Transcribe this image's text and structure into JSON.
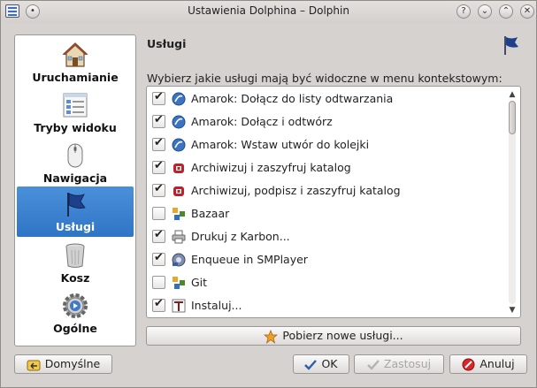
{
  "window": {
    "title": "Ustawienia Dolphina – Dolphin",
    "help_glyph": "?",
    "minimize_glyph": "⌄",
    "maximize_glyph": "⌃",
    "close_glyph": "✕",
    "menu_glyph": "•"
  },
  "sidebar": {
    "items": [
      {
        "label": "Uruchamianie",
        "icon": "house-icon",
        "selected": false
      },
      {
        "label": "Tryby widoku",
        "icon": "view-modes-icon",
        "selected": false
      },
      {
        "label": "Nawigacja",
        "icon": "mouse-icon",
        "selected": false
      },
      {
        "label": "Usługi",
        "icon": "flag-icon",
        "selected": true
      },
      {
        "label": "Kosz",
        "icon": "trash-icon",
        "selected": false
      },
      {
        "label": "Ogólne",
        "icon": "gear-icon",
        "selected": false
      }
    ]
  },
  "main": {
    "heading": "Usługi",
    "description": "Wybierz jakie usługi mają być widoczne w menu kontekstowym:",
    "services": [
      {
        "label": "Amarok: Dołącz do listy odtwarzania",
        "checked": true,
        "icon": "amarok-icon"
      },
      {
        "label": "Amarok: Dołącz i odtwórz",
        "checked": true,
        "icon": "amarok-icon"
      },
      {
        "label": "Amarok: Wstaw utwór do kolejki",
        "checked": true,
        "icon": "amarok-icon"
      },
      {
        "label": "Archiwizuj i zaszyfruj katalog",
        "checked": true,
        "icon": "archive-icon"
      },
      {
        "label": "Archiwizuj, podpisz i zaszyfruj katalog",
        "checked": true,
        "icon": "archive-icon"
      },
      {
        "label": "Bazaar",
        "checked": false,
        "icon": "vcs-icon"
      },
      {
        "label": "Drukuj z Karbon...",
        "checked": true,
        "icon": "printer-icon"
      },
      {
        "label": "Enqueue in SMPlayer",
        "checked": true,
        "icon": "smplayer-icon"
      },
      {
        "label": "Git",
        "checked": false,
        "icon": "vcs-icon"
      },
      {
        "label": "Instaluj...",
        "checked": true,
        "icon": "font-install-icon"
      }
    ],
    "get_new_label": "Pobierz nowe usługi...",
    "scroll_up": "▲",
    "scroll_down": "▼"
  },
  "buttons": {
    "defaults": "Domyślne",
    "ok": "OK",
    "apply": "Zastosuj",
    "cancel": "Anuluj"
  },
  "colors": {
    "selection": "#3a82d0",
    "window_bg": "#d6d2d0"
  }
}
